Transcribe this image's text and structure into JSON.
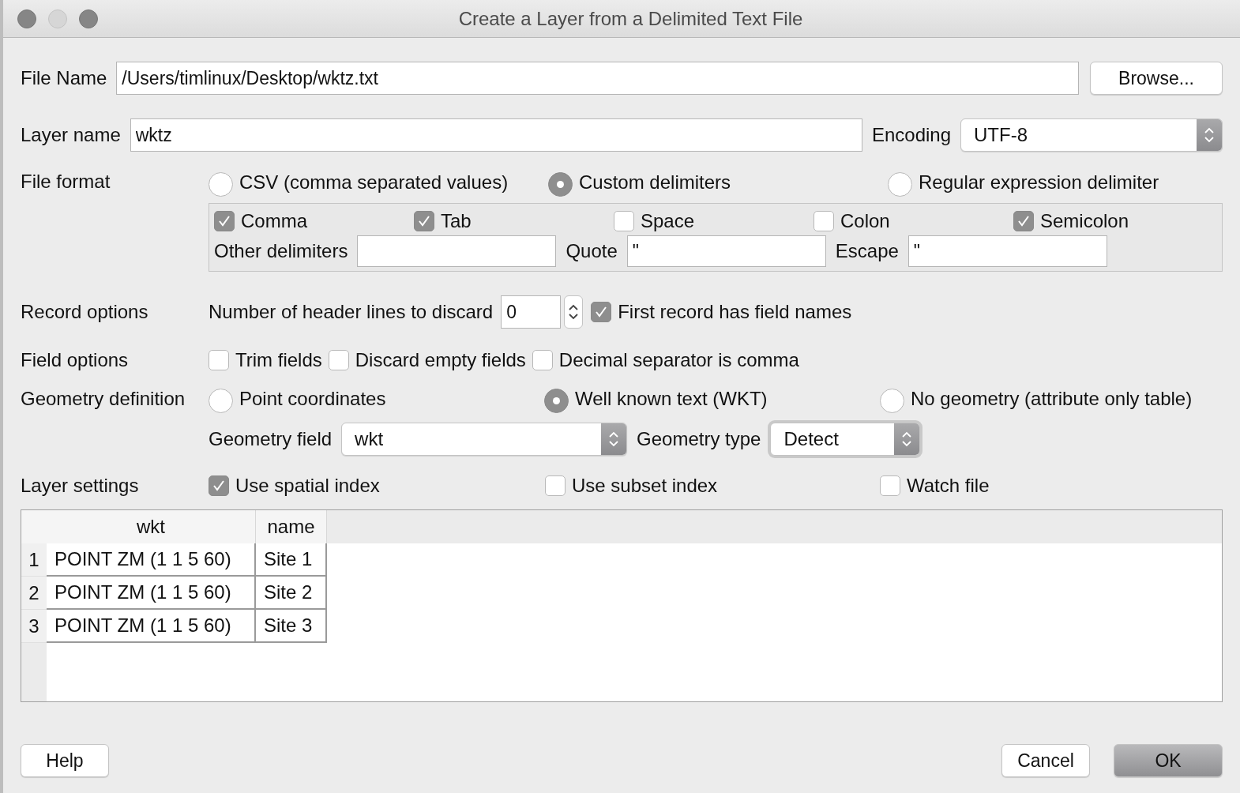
{
  "window": {
    "title": "Create a Layer from a Delimited Text File"
  },
  "file_name": {
    "label": "File Name",
    "value": "/Users/timlinux/Desktop/wktz.txt",
    "browse": "Browse..."
  },
  "layer_name": {
    "label": "Layer name",
    "value": "wktz"
  },
  "encoding": {
    "label": "Encoding",
    "value": "UTF-8"
  },
  "file_format": {
    "label": "File format",
    "options": [
      {
        "label": "CSV (comma separated values)",
        "selected": false
      },
      {
        "label": "Custom delimiters",
        "selected": true
      },
      {
        "label": "Regular expression delimiter",
        "selected": false
      }
    ],
    "delimiters": [
      {
        "label": "Comma",
        "checked": true
      },
      {
        "label": "Tab",
        "checked": true
      },
      {
        "label": "Space",
        "checked": false
      },
      {
        "label": "Colon",
        "checked": false
      },
      {
        "label": "Semicolon",
        "checked": true
      }
    ],
    "other_delimiters": {
      "label": "Other delimiters"
    },
    "quote": {
      "label": "Quote",
      "value": "\""
    },
    "escape": {
      "label": "Escape",
      "value": "\""
    }
  },
  "record_options": {
    "label": "Record options",
    "header_lines": {
      "label": "Number of header lines to discard",
      "value": "0"
    },
    "first_record": {
      "label": "First record has field names",
      "checked": true
    }
  },
  "field_options": {
    "label": "Field options",
    "options": [
      {
        "label": "Trim fields",
        "checked": false
      },
      {
        "label": "Discard empty fields",
        "checked": false
      },
      {
        "label": "Decimal separator is comma",
        "checked": false
      }
    ]
  },
  "geometry_definition": {
    "label": "Geometry definition",
    "options": [
      {
        "label": "Point coordinates",
        "selected": false
      },
      {
        "label": "Well known text (WKT)",
        "selected": true
      },
      {
        "label": "No geometry (attribute only table)",
        "selected": false
      }
    ],
    "geometry_field": {
      "label": "Geometry field",
      "value": "wkt"
    },
    "geometry_type": {
      "label": "Geometry type",
      "value": "Detect"
    }
  },
  "layer_settings": {
    "label": "Layer settings",
    "options": [
      {
        "label": "Use spatial index",
        "checked": true
      },
      {
        "label": "Use subset index",
        "checked": false
      },
      {
        "label": "Watch file",
        "checked": false
      }
    ]
  },
  "table": {
    "columns": [
      "wkt",
      "name"
    ],
    "rows": [
      {
        "number": "1",
        "cells": [
          "POINT ZM (1 1 5 60)",
          "Site 1"
        ]
      },
      {
        "number": "2",
        "cells": [
          "POINT ZM (1 1 5 60)",
          "Site 2"
        ]
      },
      {
        "number": "3",
        "cells": [
          "POINT ZM (1 1 5 60)",
          "Site 3"
        ]
      }
    ]
  },
  "buttons": [
    {
      "label": "Help",
      "kind": "plain"
    },
    {
      "label": "Cancel",
      "kind": "plain"
    },
    {
      "label": "OK",
      "kind": "default"
    }
  ]
}
